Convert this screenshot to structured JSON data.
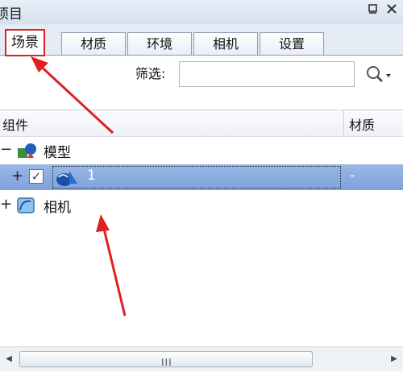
{
  "window": {
    "title": "项目",
    "pin_icon": "pin-icon",
    "close_icon": "close-icon"
  },
  "tabs": [
    {
      "label": "场景",
      "active": true
    },
    {
      "label": "材质"
    },
    {
      "label": "环境"
    },
    {
      "label": "相机"
    },
    {
      "label": "设置"
    }
  ],
  "filter": {
    "label": "筛选:",
    "value": "",
    "search_icon": "search-icon"
  },
  "table": {
    "columns": [
      "组件",
      "材质"
    ],
    "rows": [
      {
        "expander": "−",
        "icon": "model-icon",
        "label": "模型",
        "material": ""
      },
      {
        "expander": "+",
        "icon": "part-icon",
        "label": "1",
        "checked": true,
        "selected": true,
        "material": "-"
      },
      {
        "expander": "+",
        "icon": "camera-icon",
        "label": "相机",
        "material": ""
      }
    ]
  },
  "scrollbar": {
    "grip": "III"
  },
  "colors": {
    "accent_red": "#e02020",
    "selection": "#8aaee0",
    "panel_bg": "#dfe7f1"
  }
}
